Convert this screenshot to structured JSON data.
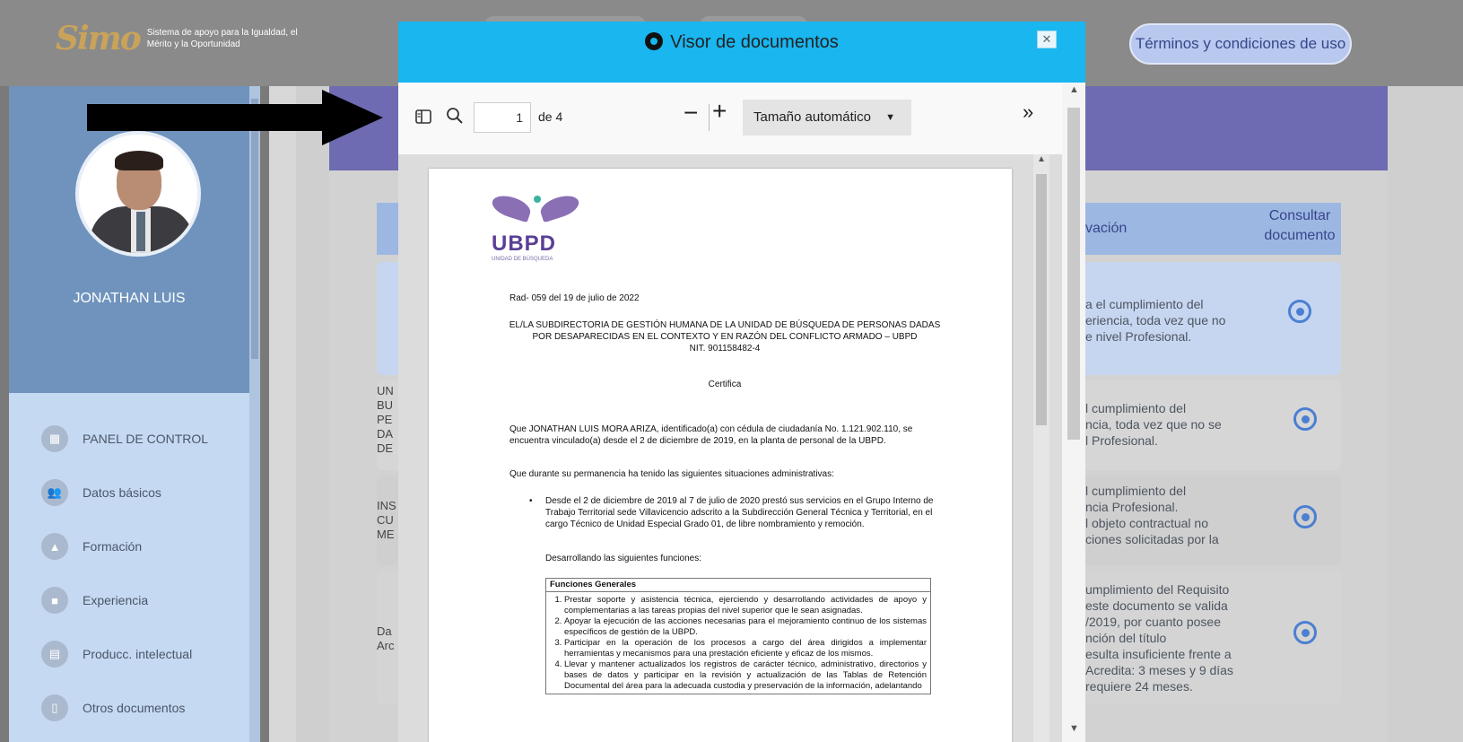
{
  "app": {
    "logo_mark": "Simo",
    "logo_text": "Sistema de apoyo para la Igualdad, el Mérito y la Oportunidad",
    "terms_button": "Términos y condiciones de uso"
  },
  "sidebar": {
    "profile_name": "JONATHAN LUIS",
    "items": [
      {
        "label": "PANEL DE CONTROL",
        "icon": "dashboard-icon"
      },
      {
        "label": "Datos básicos",
        "icon": "people-icon"
      },
      {
        "label": "Formación",
        "icon": "graduation-icon"
      },
      {
        "label": "Experiencia",
        "icon": "briefcase-icon"
      },
      {
        "label": "Producc. intelectual",
        "icon": "book-icon"
      },
      {
        "label": "Otros documentos",
        "icon": "document-icon"
      }
    ]
  },
  "table": {
    "col_observacion": "vación",
    "col_consultar": "Consultar documento",
    "rows": [
      {
        "left": "",
        "text": "a el cumplimiento del\neriencia, toda vez que no\ne nivel Profesional."
      },
      {
        "left": "UN\nBU\nPE\nDA\nDE",
        "text": "l cumplimiento del\nncia, toda vez que no se\nl Profesional."
      },
      {
        "left": "INS\nCU\nME",
        "text": "l cumplimiento del\nncia Profesional.\nl objeto contractual no\nciones solicitadas por la"
      },
      {
        "left": "Da\nArc",
        "text": "umplimiento del Requisito\neste documento se valida\n/2019, por cuanto posee\nnción del título\nesulta insuficiente frente a\nAcredita: 3 meses y 9 días\nrequiere 24 meses."
      }
    ]
  },
  "modal": {
    "title": "Visor de documentos",
    "close": "✕"
  },
  "viewer": {
    "page_number": "1",
    "page_of": "de 4",
    "zoom_label": "Tamaño automático"
  },
  "document": {
    "logo_text": "UBPD",
    "logo_sub": "UNIDAD DE BÚSQUEDA",
    "rad": "Rad- 059 del 19 de julio de 2022",
    "heading1": "EL/LA SUBDIRECTORIA DE GESTIÓN HUMANA DE LA UNIDAD DE BÚSQUEDA DE PERSONAS DADAS",
    "heading2": "POR DESAPARECIDAS EN EL CONTEXTO Y EN RAZÓN DEL CONFLICTO ARMADO – UBPD",
    "nit": "NIT. 901158482-4",
    "certifica": "Certifica",
    "p1a": "Que JONATHAN LUIS MORA ARIZA, identificado(a) con cédula de ciudadanía No. 1.121.902.110, se",
    "p1b": "encuentra vinculado(a) desde el 2 de diciembre de 2019, en la planta de personal de la UBPD.",
    "p2": "Que durante su permanencia ha tenido las siguientes situaciones administrativas:",
    "b1a": "Desde el 2 de diciembre de 2019 al 7 de julio de 2020 prestó sus servicios en el Grupo Interno de",
    "b1b": "Trabajo Territorial sede Villavicencio adscrito a la Subdirección General Técnica y Territorial, en el",
    "b1c": "cargo Técnico de Unidad Especial Grado 01, de libre nombramiento y remoción.",
    "p3": "Desarrollando las siguientes funciones:",
    "func_header": "Funciones Generales",
    "functions": [
      "Prestar soporte y asistencia técnica, ejerciendo y desarrollando actividades de apoyo y complementarias a las tareas propias del nivel superior que le sean asignadas.",
      "Apoyar la ejecución de las acciones necesarias para el mejoramiento continuo de los sistemas específicos de gestión de la UBPD.",
      "Participar en la operación de los procesos a cargo del área dirigidos a implementar herramientas y mecanismos para una prestación eficiente y eficaz de los mismos.",
      "Llevar y mantener actualizados los registros de carácter técnico, administrativo, directorios y bases de datos y participar en la revisión y actualización de las Tablas de Retención Documental del área para la adecuada custodia y preservación de la información, adelantando"
    ]
  }
}
